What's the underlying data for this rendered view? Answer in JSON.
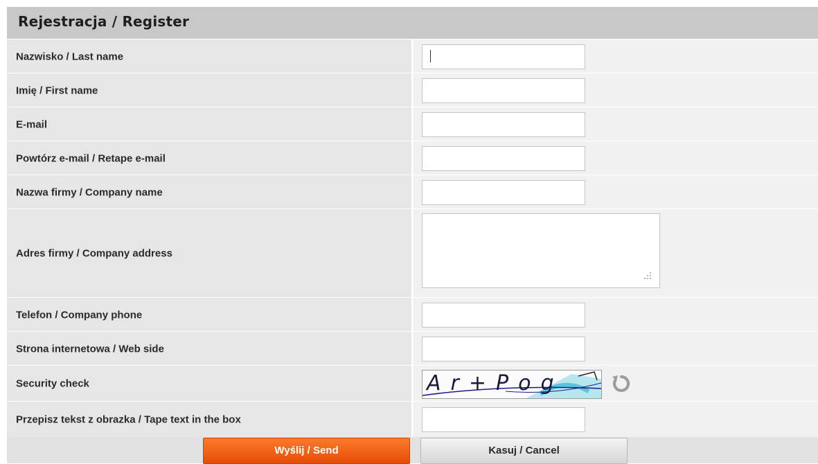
{
  "form": {
    "title": "Rejestracja / Register",
    "fields": [
      {
        "label": "Nazwisko / Last name",
        "value": ""
      },
      {
        "label": "Imię / First name",
        "value": ""
      },
      {
        "label": "E-mail",
        "value": ""
      },
      {
        "label": "Powtórz e-mail / Retape e-mail",
        "value": ""
      },
      {
        "label": "Nazwa firmy / Company name",
        "value": ""
      },
      {
        "label": "Adres firmy / Company address",
        "value": ""
      },
      {
        "label": "Telefon / Company phone",
        "value": ""
      },
      {
        "label": "Strona internetowa / Web side",
        "value": ""
      },
      {
        "label": "Security check",
        "captcha_text": "Ar+Pog"
      },
      {
        "label": "Przepisz tekst z obrazka / Tape text in the box",
        "value": ""
      }
    ],
    "buttons": {
      "send_label": "Wyślij / Send",
      "cancel_label": "Kasuj / Cancel"
    }
  },
  "colors": {
    "title_bg": "#c8c8c8",
    "label_bg": "#e6e6e6",
    "field_bg": "#f1f1f1",
    "send_button": "#f2620f",
    "cancel_button": "#e0e0e0"
  },
  "icons": {
    "refresh": "refresh-icon",
    "resize": "resize-grip-icon"
  }
}
